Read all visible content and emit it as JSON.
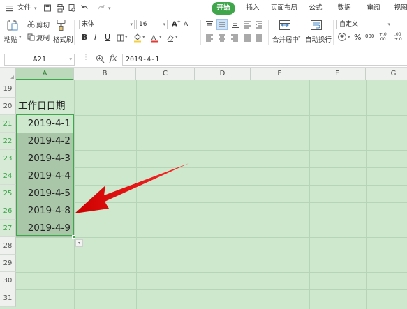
{
  "menubar": {
    "file_label": "文件",
    "tabs": [
      {
        "label": "开始",
        "active": true
      },
      {
        "label": "插入",
        "active": false
      },
      {
        "label": "页面布局",
        "active": false
      },
      {
        "label": "公式",
        "active": false
      },
      {
        "label": "数据",
        "active": false
      },
      {
        "label": "审阅",
        "active": false
      },
      {
        "label": "视图",
        "active": false
      }
    ]
  },
  "ribbon": {
    "paste_label": "粘贴",
    "cut_label": "剪切",
    "copy_label": "复制",
    "format_painter_label": "格式刷",
    "font_name": "宋体",
    "font_size": "16",
    "merge_center_label": "合并居中",
    "wrap_text_label": "自动换行",
    "number_format": "自定义",
    "currency_symbol": "¥",
    "percent_symbol": "%",
    "comma_symbol": "000",
    "increase_decimal": "+.0 .00",
    "decrease_decimal": ".00 +.0"
  },
  "formula_bar": {
    "name_box": "A21",
    "fx_label": "fx",
    "formula": "2019-4-1"
  },
  "grid": {
    "columns": [
      "A",
      "B",
      "C",
      "D",
      "E",
      "F",
      "G"
    ],
    "rows": [
      "19",
      "20",
      "21",
      "22",
      "23",
      "24",
      "25",
      "26",
      "27",
      "28",
      "29",
      "30",
      "31"
    ],
    "header_cell": "工作日日期",
    "dates": [
      "2019-4-1",
      "2019-4-2",
      "2019-4-3",
      "2019-4-4",
      "2019-4-5",
      "2019-4-8",
      "2019-4-9"
    ]
  },
  "colors": {
    "accent": "#3fa64c",
    "grid_background": "#cde8cd",
    "selection_fill": "#a9c6a9",
    "arrow": "#ee1111"
  }
}
